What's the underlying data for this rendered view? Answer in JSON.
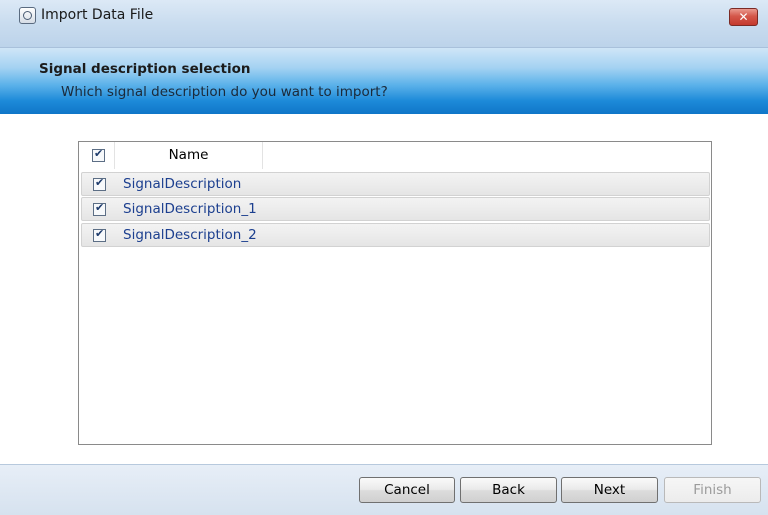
{
  "window": {
    "title": "Import Data File",
    "close_glyph": "✕"
  },
  "header": {
    "title": "Signal description selection",
    "subtitle": "Which signal description do you want to import?"
  },
  "grid": {
    "columns": [
      {
        "label": "Name"
      }
    ],
    "header_checked": true,
    "rows": [
      {
        "name": "SignalDescription",
        "checked": true
      },
      {
        "name": "SignalDescription_1",
        "checked": true
      },
      {
        "name": "SignalDescription_2",
        "checked": true
      }
    ]
  },
  "buttons": {
    "cancel": "Cancel",
    "back": "Back",
    "next": "Next",
    "finish": "Finish"
  },
  "colors": {
    "accent": "#1d8ad9",
    "link_text": "#1c3f8f",
    "close_red": "#c4392d"
  },
  "icons": {
    "app": "app-dialog-icon",
    "close": "close-icon",
    "checkbox": "checkbox-checked-icon"
  }
}
